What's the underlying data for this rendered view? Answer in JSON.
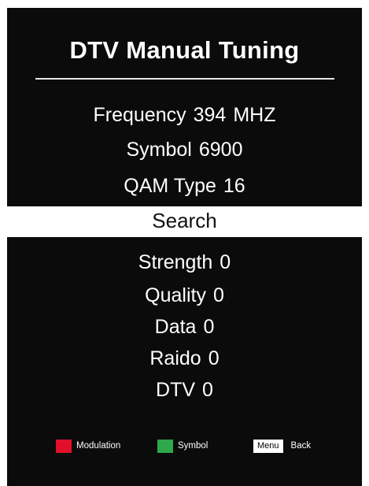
{
  "title": "DTV Manual Tuning",
  "params": {
    "frequency": {
      "label": "Frequency",
      "value": "394",
      "unit": "MHZ"
    },
    "symbol": {
      "label": "Symbol",
      "value": "6900"
    },
    "qam": {
      "label": "QAM Type",
      "value": "16"
    }
  },
  "search": {
    "label": "Search"
  },
  "stats": {
    "strength": {
      "label": "Strength",
      "value": "0"
    },
    "quality": {
      "label": "Quality",
      "value": "0"
    },
    "data": {
      "label": "Data",
      "value": "0"
    },
    "radio": {
      "label": "Raido",
      "value": "0"
    },
    "dtv": {
      "label": "DTV",
      "value": "0"
    }
  },
  "hints": {
    "modulation": {
      "label": "Modulation",
      "color": "#e0102a"
    },
    "symbol": {
      "label": "Symbol",
      "color": "#2ea84a"
    },
    "back": {
      "key": "Menu",
      "label": "Back"
    }
  }
}
